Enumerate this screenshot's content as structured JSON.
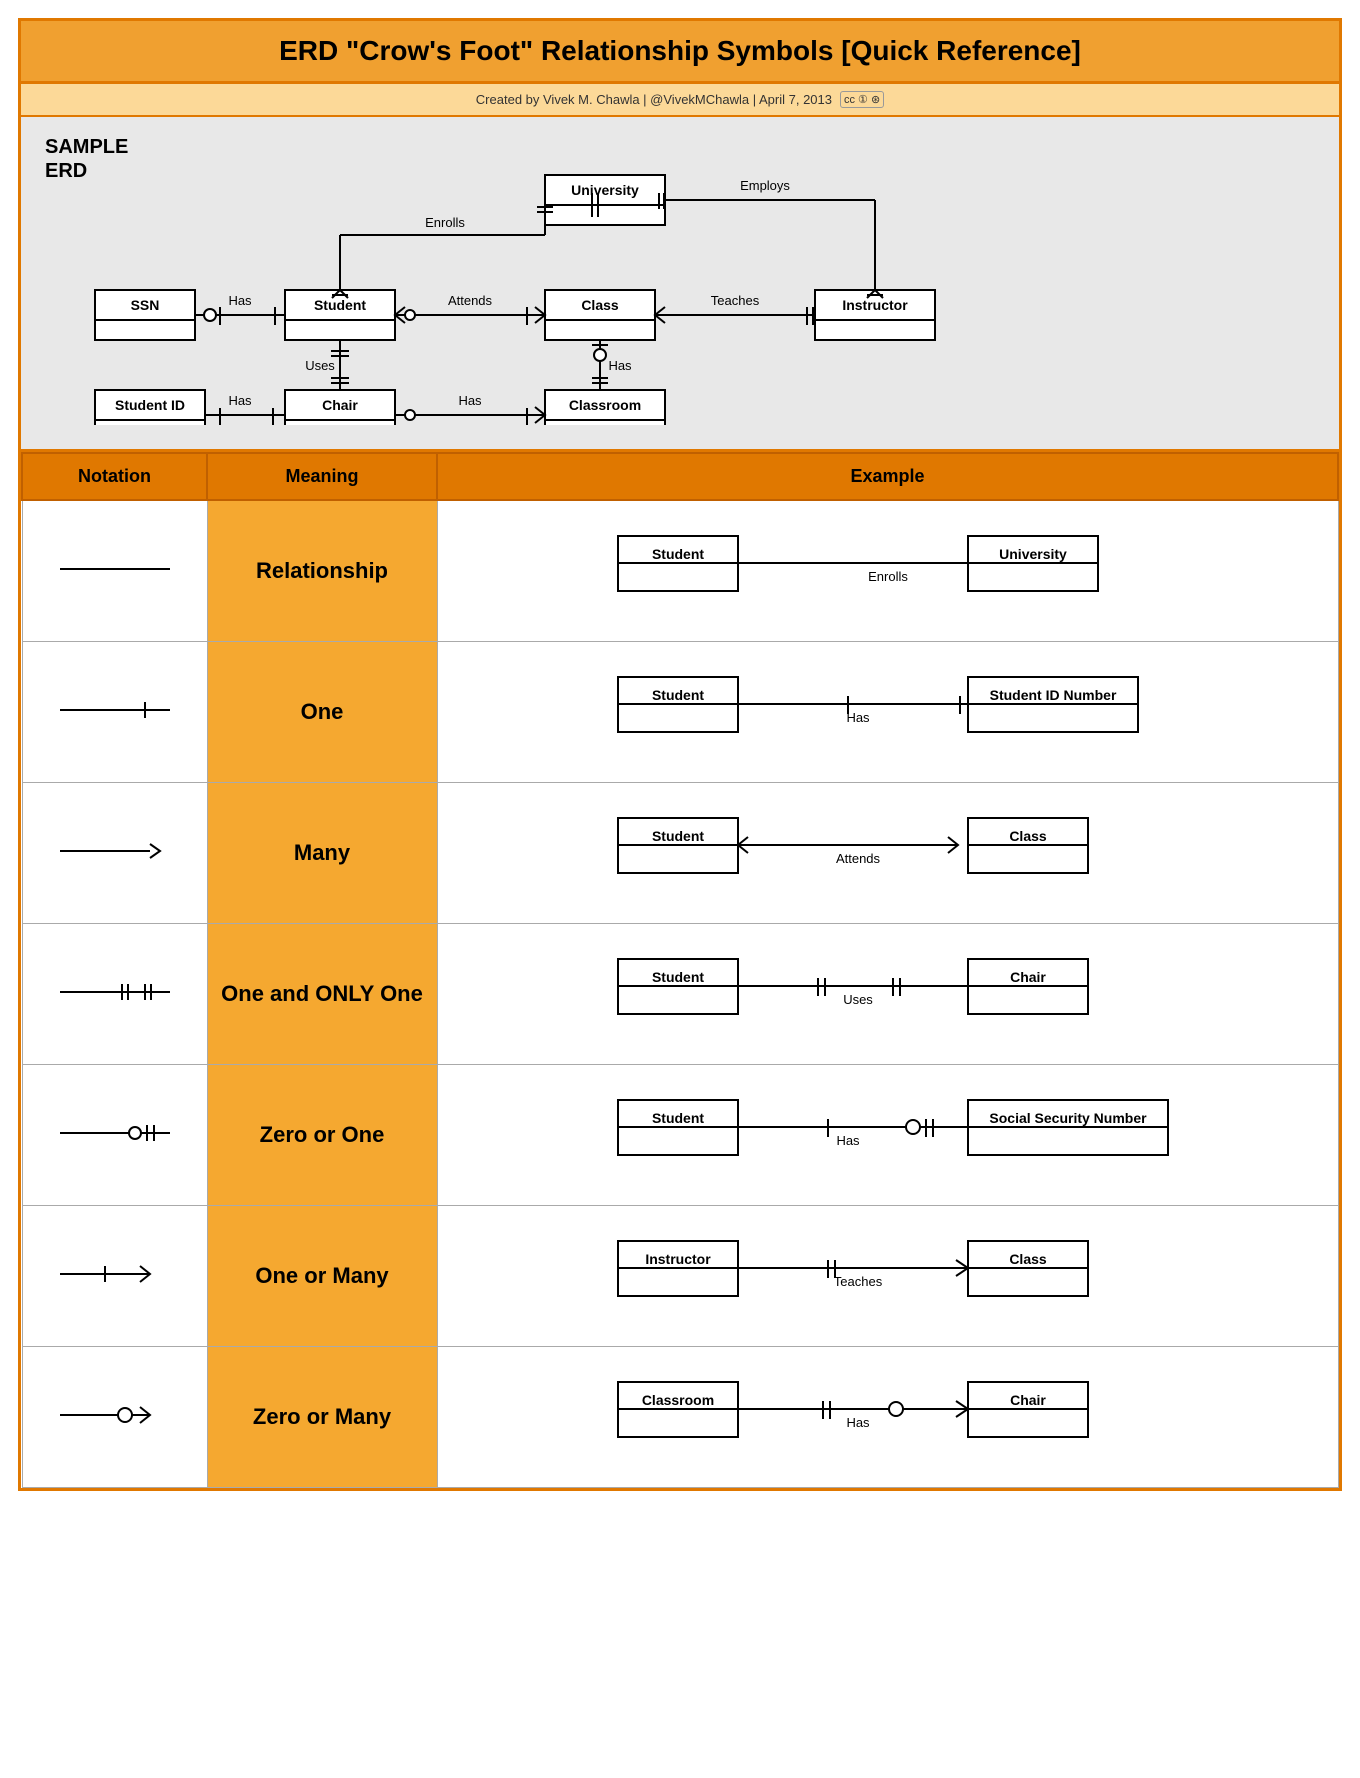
{
  "title": "ERD \"Crow's Foot\" Relationship Symbols [Quick Reference]",
  "credits": "Created by Vivek M. Chawla  |  @VivekMChawla  |  April 7, 2013",
  "header": {
    "notation": "Notation",
    "meaning": "Meaning",
    "example": "Example"
  },
  "erd_label": "SAMPLE\nERD",
  "rows": [
    {
      "meaning": "Relationship",
      "example_left": "Student",
      "example_right": "University",
      "example_rel": "Enrolls"
    },
    {
      "meaning": "One",
      "example_left": "Student",
      "example_right": "Student ID Number",
      "example_rel": "Has"
    },
    {
      "meaning": "Many",
      "example_left": "Student",
      "example_right": "Class",
      "example_rel": "Attends"
    },
    {
      "meaning": "One and ONLY One",
      "example_left": "Student",
      "example_right": "Chair",
      "example_rel": "Uses"
    },
    {
      "meaning": "Zero or One",
      "example_left": "Student",
      "example_right": "Social Security Number",
      "example_rel": "Has"
    },
    {
      "meaning": "One or Many",
      "example_left": "Instructor",
      "example_right": "Class",
      "example_rel": "Teaches"
    },
    {
      "meaning": "Zero or Many",
      "example_left": "Classroom",
      "example_right": "Chair",
      "example_rel": "Has"
    }
  ]
}
